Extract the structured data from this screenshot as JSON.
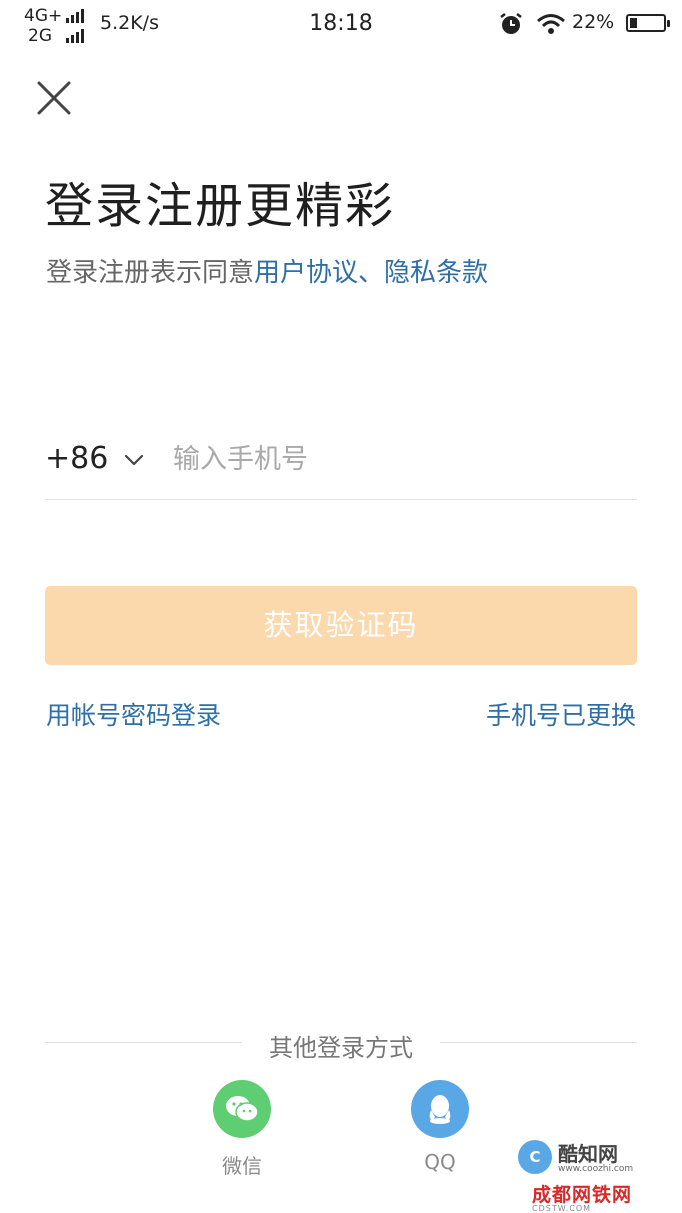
{
  "status_bar": {
    "network_top": "4G+",
    "network_bottom": "2G",
    "speed": "5.2K/s",
    "time": "18:18",
    "battery": "22%",
    "battery_level": 0.22,
    "icons": [
      "signal-bars-icon",
      "alarm-icon",
      "wifi-icon",
      "battery-icon"
    ]
  },
  "header": {
    "close_icon": "close-icon",
    "title": "登录注册更精彩",
    "agreement_prefix": "登录注册表示同意",
    "user_agreement": "用户协议",
    "separator": "、",
    "privacy_terms": "隐私条款"
  },
  "form": {
    "country_code": "+86",
    "phone_placeholder": "输入手机号",
    "phone_value": "",
    "get_code_button": "获取验证码"
  },
  "links": {
    "password_login": "用帐号密码登录",
    "phone_changed": "手机号已更换"
  },
  "other_login": {
    "label": "其他登录方式",
    "options": [
      {
        "label": "微信",
        "icon": "wechat-icon"
      },
      {
        "label": "QQ",
        "icon": "qq-icon"
      }
    ]
  },
  "watermarks": {
    "coozhi_name": "酷知网",
    "coozhi_url": "www.coozhi.com",
    "cdtw_name": "成都网铁网",
    "cdtw_url": "CDSTW.COM"
  },
  "colors": {
    "link": "#2f6fa6",
    "button_disabled": "#fcd9ad",
    "wechat": "#5fcd72",
    "qq": "#5aa7e6"
  }
}
